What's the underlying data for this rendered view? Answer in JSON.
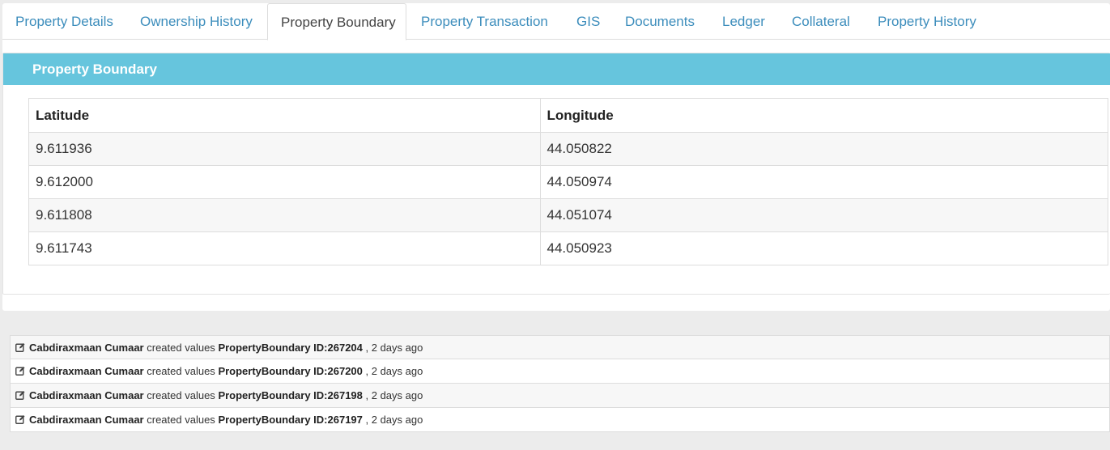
{
  "tabs": [
    {
      "label": "Property Details",
      "active": false
    },
    {
      "label": "Ownership History",
      "active": false
    },
    {
      "label": "Property Boundary",
      "active": true
    },
    {
      "label": "Property Transaction",
      "active": false
    },
    {
      "label": "GIS",
      "active": false
    },
    {
      "label": "Documents",
      "active": false
    },
    {
      "label": "Ledger",
      "active": false
    },
    {
      "label": "Collateral",
      "active": false
    },
    {
      "label": "Property History",
      "active": false
    }
  ],
  "panel": {
    "title": "Property Boundary",
    "header_color": "#66c5dd"
  },
  "table": {
    "headers": [
      "Latitude",
      "Longitude"
    ],
    "rows": [
      [
        "9.611936",
        "44.050822"
      ],
      [
        "9.612000",
        "44.050974"
      ],
      [
        "9.611808",
        "44.051074"
      ],
      [
        "9.611743",
        "44.050923"
      ]
    ]
  },
  "activity": [
    {
      "icon": "edit-icon",
      "user": "Cabdiraxmaan Cumaar",
      "action": "created values",
      "target": "PropertyBoundary ID:267204",
      "time": ", 2 days ago"
    },
    {
      "icon": "edit-icon",
      "user": "Cabdiraxmaan Cumaar",
      "action": "created values",
      "target": "PropertyBoundary ID:267200",
      "time": ", 2 days ago"
    },
    {
      "icon": "edit-icon",
      "user": "Cabdiraxmaan Cumaar",
      "action": "created values",
      "target": "PropertyBoundary ID:267198",
      "time": ", 2 days ago"
    },
    {
      "icon": "edit-icon",
      "user": "Cabdiraxmaan Cumaar",
      "action": "created values",
      "target": "PropertyBoundary ID:267197",
      "time": ", 2 days ago"
    }
  ],
  "colors": {
    "link": "#3c8dbc",
    "accent": "#66c5dd"
  }
}
